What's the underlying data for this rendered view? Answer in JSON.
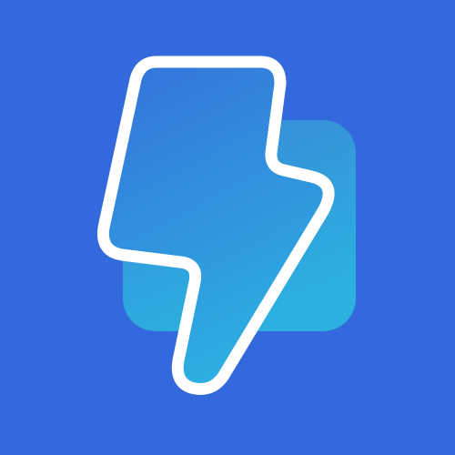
{
  "logo": {
    "icon_name": "lightning-bolt-icon",
    "colors": {
      "background": "#3369dc",
      "back_square_top": "#3a88d6",
      "back_square_bottom": "#2bb0e0",
      "bolt_top": "#3575db",
      "bolt_bottom": "#2cb2e1",
      "bolt_outline": "#ffffff"
    }
  }
}
